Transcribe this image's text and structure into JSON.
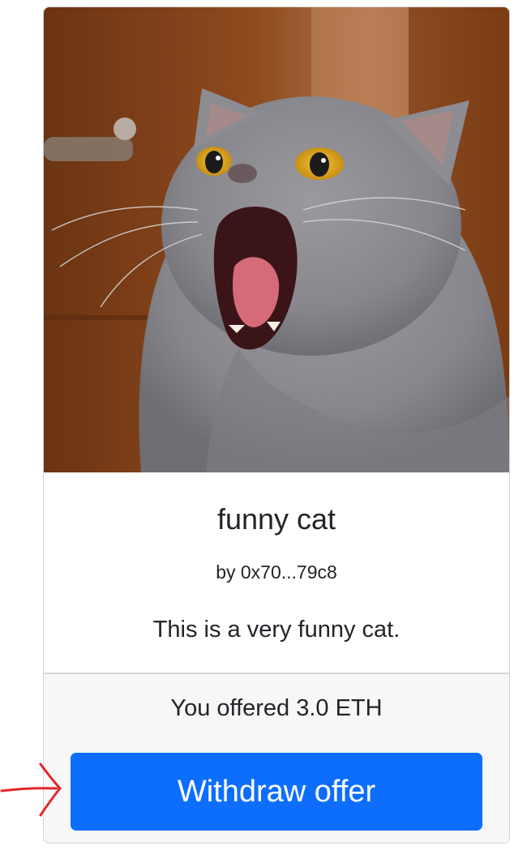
{
  "nft_card": {
    "image_alt": "photo of a surprised grey cat with open mouth",
    "title": "funny cat",
    "author": "by 0x70...79c8",
    "description": "This is a very funny cat.",
    "offer_text": "You offered 3.0 ETH",
    "withdraw_button_label": "Withdraw offer"
  },
  "colors": {
    "button": "#0d6efd",
    "footer_bg": "#f7f7f7",
    "annotation": "#e5262a"
  },
  "icons": [
    "cat-photo",
    "annotation-arrow-icon"
  ]
}
